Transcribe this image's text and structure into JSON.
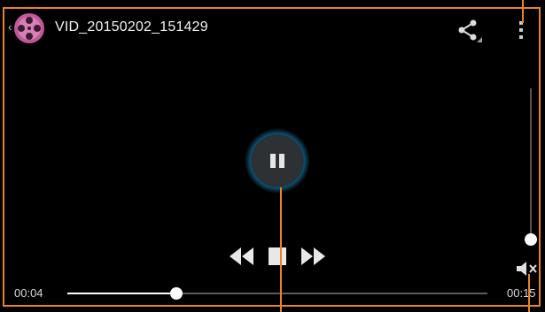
{
  "header": {
    "back_glyph": "‹",
    "app_icon": "film-reel-icon",
    "title": "VID_20150202_151429",
    "share_icon": "share-icon",
    "more_icon": "more-vert-icon"
  },
  "player": {
    "state": "playing",
    "pause_icon": "pause-icon",
    "transport_icons": [
      "rewind-icon",
      "stop-icon",
      "fast-forward-icon"
    ],
    "elapsed": "00:04",
    "duration": "00:15",
    "progress_fraction": 0.26,
    "volume_fraction": 0.0,
    "mute_icon": "volume-mute-icon"
  },
  "colors": {
    "background": "#000000",
    "callout": "#e8822a",
    "app_icon": "#c2589a",
    "glow": "#1e90c8"
  }
}
